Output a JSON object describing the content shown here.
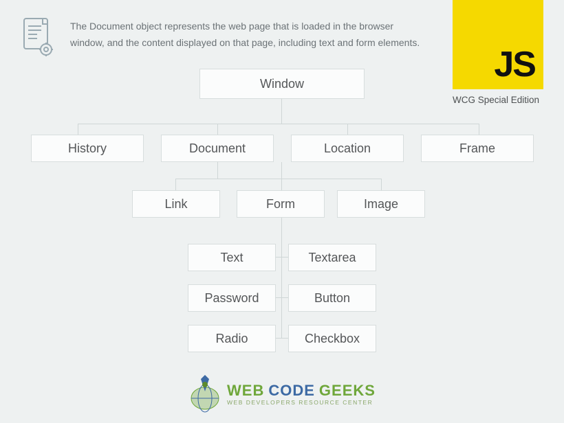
{
  "header": {
    "description": "The Document object represents the web page that is loaded in the browser window, and the content displayed on that page, including text and form elements."
  },
  "badge": {
    "letters": "JS",
    "subtitle": "WCG Special Edition"
  },
  "tree": {
    "root": "Window",
    "level2": [
      "History",
      "Document",
      "Location",
      "Frame"
    ],
    "level3": [
      "Link",
      "Form",
      "Image"
    ],
    "level4_left": [
      "Text",
      "Password",
      "Radio"
    ],
    "level4_right": [
      "Textarea",
      "Button",
      "Checkbox"
    ]
  },
  "footer": {
    "brand_word1": "WEB",
    "brand_word2": "CODE",
    "brand_word3": "GEEKS",
    "tagline": "WEB DEVELOPERS RESOURCE CENTER"
  }
}
